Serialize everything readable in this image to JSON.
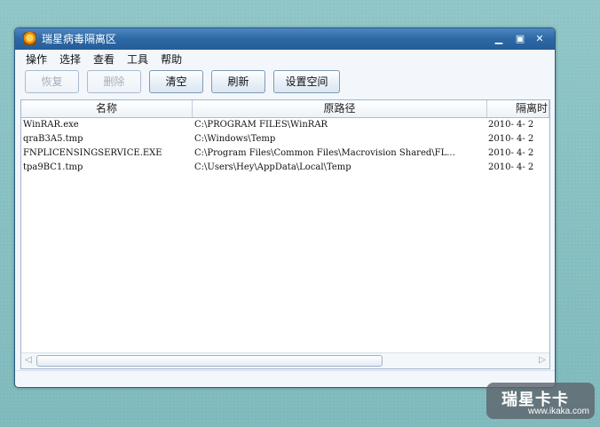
{
  "window": {
    "title": "瑞星病毒隔离区",
    "controls": [
      "minimize-icon",
      "maximize-icon",
      "close-icon"
    ]
  },
  "menu": {
    "items": [
      "操作",
      "选择",
      "查看",
      "工具",
      "帮助"
    ]
  },
  "toolbar": {
    "restore_label": "恢复",
    "delete_label": "删除",
    "clear_label": "清空",
    "refresh_label": "刷新",
    "space_label": "设置空间",
    "disabled": [
      "恢复",
      "删除"
    ]
  },
  "table": {
    "headers": [
      "名称",
      "原路径",
      "隔离时"
    ],
    "rows": [
      [
        "WinRAR.exe",
        "C:\\PROGRAM FILES\\WinRAR",
        "2010- 4- 2"
      ],
      [
        "qraB3A5.tmp",
        "C:\\Windows\\Temp",
        "2010- 4- 2"
      ],
      [
        "FNPLICENSINGSERVICE.EXE",
        "C:\\Program Files\\Common Files\\Macrovision Shared\\FL...",
        "2010- 4- 2"
      ],
      [
        "tpa9BC1.tmp",
        "C:\\Users\\Hey\\AppData\\Local\\Temp",
        "2010- 4- 2"
      ]
    ]
  },
  "watermark": {
    "title": "瑞星卡卡",
    "url": "www.ikaka.com"
  },
  "colors": {
    "titlebar": "#2f6aa6",
    "window_bg": "#f3f7fb",
    "desktop": "#86bfc1"
  }
}
